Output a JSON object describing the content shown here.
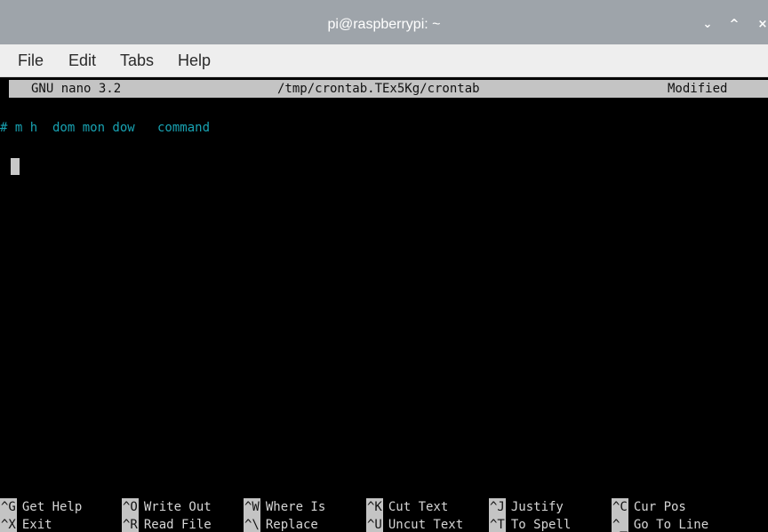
{
  "window": {
    "title": "pi@raspberrypi: ~",
    "controls": [
      {
        "name": "minimize",
        "icon": "chevron-down-icon",
        "glyph": "⌄"
      },
      {
        "name": "maximize",
        "icon": "chevron-up-icon",
        "glyph": "^"
      },
      {
        "name": "close",
        "icon": "close-icon",
        "glyph": "×"
      }
    ]
  },
  "menu": [
    "File",
    "Edit",
    "Tabs",
    "Help"
  ],
  "nano": {
    "version": "GNU nano 3.2",
    "filename": "/tmp/crontab.TEx5Kg/crontab",
    "status": "Modified",
    "content_line": "# m h  dom mon dow   command"
  },
  "shortcuts": {
    "row1": [
      {
        "key": "^G",
        "label": "Get Help"
      },
      {
        "key": "^O",
        "label": "Write Out"
      },
      {
        "key": "^W",
        "label": "Where Is"
      },
      {
        "key": "^K",
        "label": "Cut Text"
      },
      {
        "key": "^J",
        "label": "Justify"
      },
      {
        "key": "^C",
        "label": "Cur Pos"
      }
    ],
    "row2": [
      {
        "key": "^X",
        "label": "Exit"
      },
      {
        "key": "^R",
        "label": "Read File"
      },
      {
        "key": "^\\",
        "label": "Replace"
      },
      {
        "key": "^U",
        "label": "Uncut Text"
      },
      {
        "key": "^T",
        "label": "To Spell"
      },
      {
        "key": "^_",
        "label": "Go To Line"
      }
    ]
  },
  "colors": {
    "titlebar": "#9ea4aa",
    "menubar": "#eeeeee",
    "terminal_bg": "#000000",
    "header_bg": "#c4c4c4",
    "comment": "#18a2b2"
  }
}
